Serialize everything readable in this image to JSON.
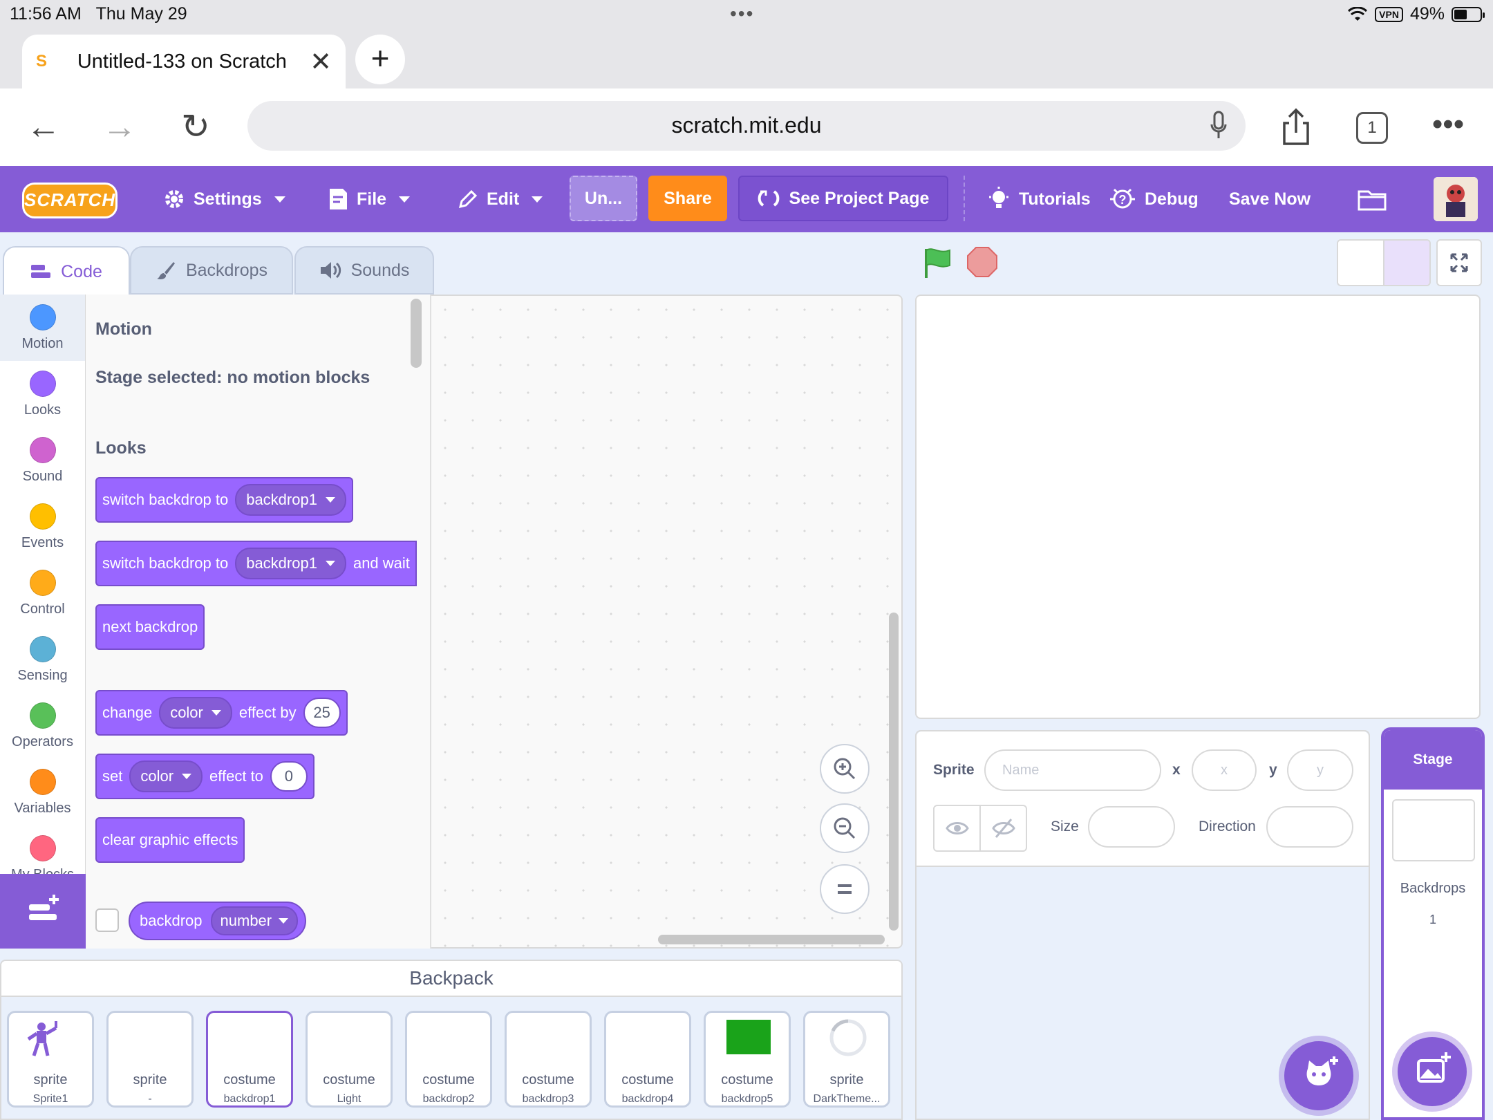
{
  "status_bar": {
    "time": "11:56 AM",
    "date": "Thu May 29",
    "vpn": "VPN",
    "battery": "49%"
  },
  "browser": {
    "tab_title": "Untitled-133 on Scratch",
    "url": "scratch.mit.edu",
    "tab_count": "1"
  },
  "menubar": {
    "logo": "SCRATCH",
    "settings": "Settings",
    "file": "File",
    "edit": "Edit",
    "project_title": "Un...",
    "share": "Share",
    "see_project_page": "See Project Page",
    "tutorials": "Tutorials",
    "debug": "Debug",
    "save_now": "Save Now"
  },
  "editor_tabs": [
    "Code",
    "Backdrops",
    "Sounds"
  ],
  "categories": [
    {
      "label": "Motion",
      "color": "#4c97ff"
    },
    {
      "label": "Looks",
      "color": "#9966ff"
    },
    {
      "label": "Sound",
      "color": "#cf63cf"
    },
    {
      "label": "Events",
      "color": "#ffbf00"
    },
    {
      "label": "Control",
      "color": "#ffab19"
    },
    {
      "label": "Sensing",
      "color": "#5cb1d6"
    },
    {
      "label": "Operators",
      "color": "#59c059"
    },
    {
      "label": "Variables",
      "color": "#ff8c1a"
    },
    {
      "label": "My Blocks",
      "color": "#ff6680"
    }
  ],
  "palette": {
    "motion_title": "Motion",
    "motion_msg": "Stage selected: no motion blocks",
    "looks_title": "Looks",
    "blocks": {
      "switch_backdrop": {
        "text": "switch backdrop to",
        "menu": "backdrop1"
      },
      "switch_backdrop_wait": {
        "text": "switch backdrop to",
        "menu": "backdrop1",
        "suffix": "and wait"
      },
      "next_backdrop": {
        "text": "next backdrop"
      },
      "change_effect": {
        "text": "change",
        "menu": "color",
        "mid": "effect by",
        "value": "25"
      },
      "set_effect": {
        "text": "set",
        "menu": "color",
        "mid": "effect to",
        "value": "0"
      },
      "clear_effects": {
        "text": "clear graphic effects"
      },
      "backdrop_reporter": {
        "text": "backdrop",
        "menu": "number"
      }
    }
  },
  "backpack": {
    "title": "Backpack",
    "items": [
      {
        "kind": "sprite",
        "name": "Sprite1"
      },
      {
        "kind": "sprite",
        "name": "-"
      },
      {
        "kind": "costume",
        "name": "backdrop1"
      },
      {
        "kind": "costume",
        "name": "Light"
      },
      {
        "kind": "costume",
        "name": "backdrop2"
      },
      {
        "kind": "costume",
        "name": "backdrop3"
      },
      {
        "kind": "costume",
        "name": "backdrop4"
      },
      {
        "kind": "costume",
        "name": "backdrop5"
      },
      {
        "kind": "sprite",
        "name": "DarkTheme..."
      }
    ]
  },
  "sprite_info": {
    "sprite_label": "Sprite",
    "name_placeholder": "Name",
    "x_label": "x",
    "x_placeholder": "x",
    "y_label": "y",
    "y_placeholder": "y",
    "size_label": "Size",
    "direction_label": "Direction"
  },
  "stage_pane": {
    "header": "Stage",
    "backdrops_label": "Backdrops",
    "backdrops_count": "1"
  },
  "colors": {
    "accent": "#855cd6",
    "looks": "#9966ff",
    "share": "#ff8c1a"
  }
}
